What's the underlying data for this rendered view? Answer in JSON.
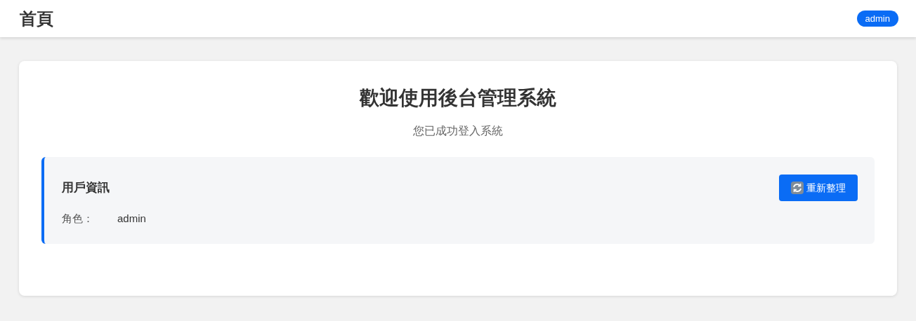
{
  "header": {
    "title": "首頁",
    "user_badge": "admin"
  },
  "welcome": {
    "title": "歡迎使用後台管理系統",
    "subtitle": "您已成功登入系統"
  },
  "user_info": {
    "title": "用戶資訊",
    "refresh_button": "重新整理",
    "fields": [
      {
        "label": "角色：",
        "value": "admin"
      }
    ]
  }
}
